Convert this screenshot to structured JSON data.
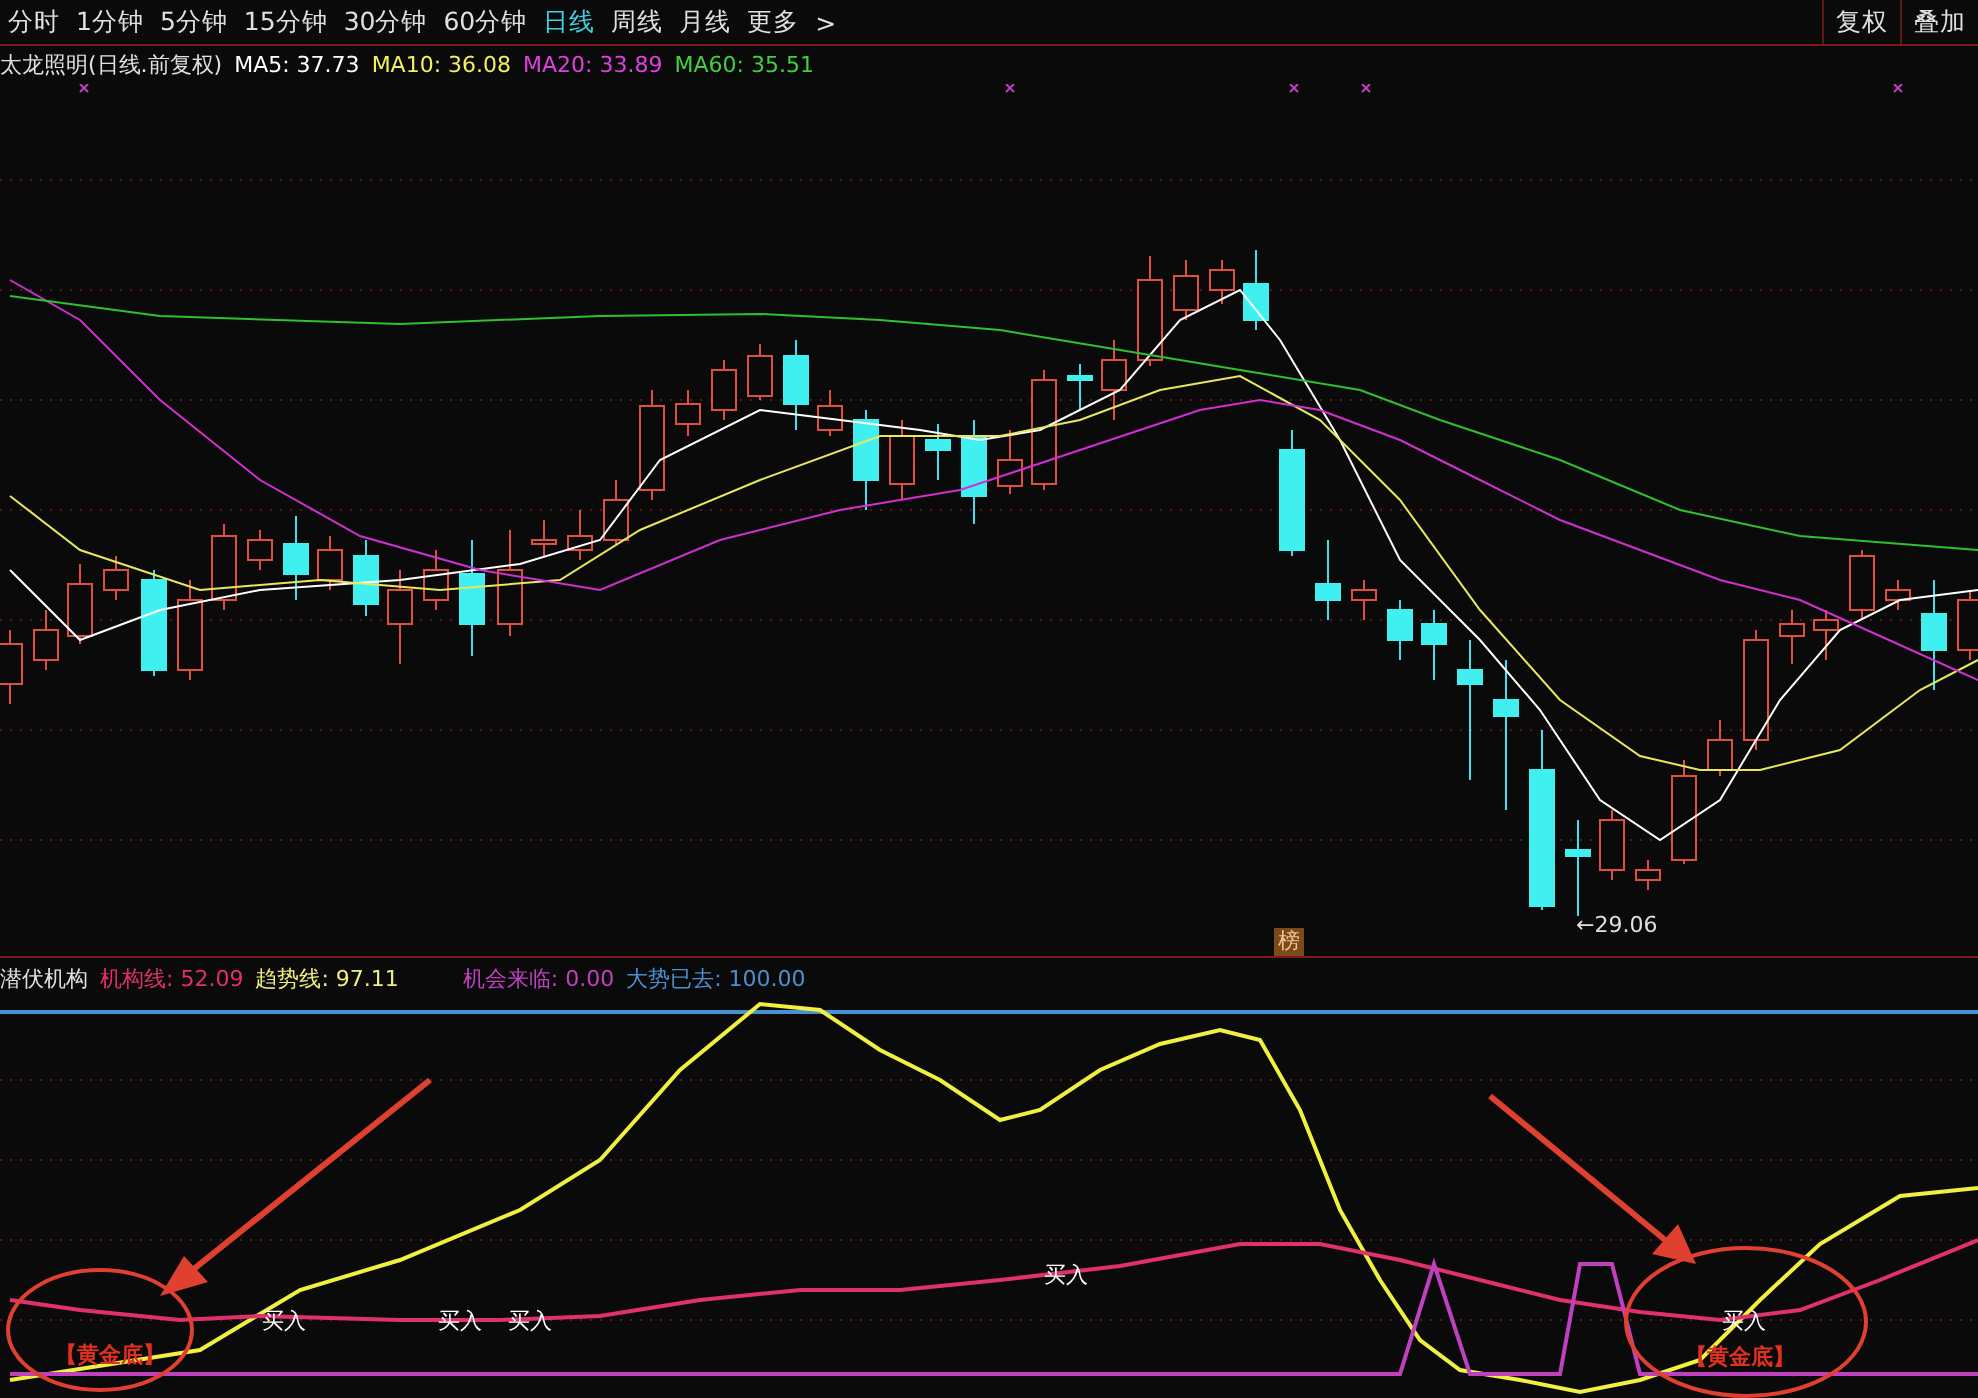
{
  "toolbar": {
    "periods": [
      {
        "label": "分时",
        "selected": false
      },
      {
        "label": "1分钟",
        "selected": false
      },
      {
        "label": "5分钟",
        "selected": false
      },
      {
        "label": "15分钟",
        "selected": false
      },
      {
        "label": "30分钟",
        "selected": false
      },
      {
        "label": "60分钟",
        "selected": false
      },
      {
        "label": "日线",
        "selected": true
      },
      {
        "label": "周线",
        "selected": false
      },
      {
        "label": "月线",
        "selected": false
      },
      {
        "label": "更多",
        "selected": false
      }
    ],
    "more_arrow": ">",
    "buttons": [
      "复权",
      "叠加"
    ]
  },
  "legend": {
    "title": "太龙照明(日线.前复权)",
    "items": [
      {
        "label": "MA5: 37.73",
        "color": "#ffffff"
      },
      {
        "label": "MA10: 36.08",
        "color": "#f0f060"
      },
      {
        "label": "MA20: 33.89",
        "color": "#e040e0"
      },
      {
        "label": "MA60: 35.51",
        "color": "#40d040"
      }
    ]
  },
  "main_chart": {
    "low_label": "←29.06",
    "badge": "榜"
  },
  "indicator": {
    "title": "潜伏机构",
    "items": [
      {
        "label": "机构线: 52.09",
        "color": "#e03070"
      },
      {
        "label": "趋势线: 97.11",
        "color": "#f0f080"
      },
      {
        "label": "机会来临: 0.00",
        "color": "#c040c0"
      },
      {
        "label": "大势已去: 100.00",
        "color": "#4a90d0"
      }
    ],
    "signals": [
      "买入",
      "买入",
      "买入",
      "买入",
      "买入"
    ],
    "tags": [
      "【黄金底】",
      "【黄金底】"
    ]
  }
}
